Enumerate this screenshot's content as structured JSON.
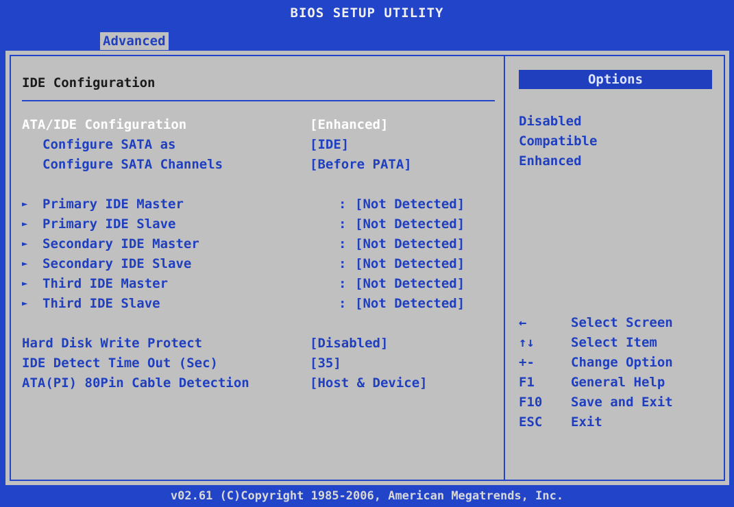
{
  "header": {
    "title": "BIOS SETUP UTILITY",
    "active_tab": "Advanced"
  },
  "section": {
    "title": "IDE Configuration"
  },
  "settings": [
    {
      "label": "ATA/IDE Configuration",
      "value": "[Enhanced]",
      "selected": true
    },
    {
      "label": "Configure SATA as",
      "value": "[IDE]"
    },
    {
      "label": "Configure SATA Channels",
      "value": "[Before PATA]"
    }
  ],
  "submenus": [
    {
      "label": "Primary IDE Master",
      "value": "[Not Detected]"
    },
    {
      "label": "Primary IDE Slave",
      "value": "[Not Detected]"
    },
    {
      "label": "Secondary IDE Master",
      "value": "[Not Detected]"
    },
    {
      "label": "Secondary IDE Slave",
      "value": "[Not Detected]"
    },
    {
      "label": "Third IDE Master",
      "value": "[Not Detected]"
    },
    {
      "label": "Third IDE Slave",
      "value": "[Not Detected]"
    }
  ],
  "misc_settings": [
    {
      "label": "Hard Disk Write Protect",
      "value": "[Disabled]"
    },
    {
      "label": "IDE Detect Time Out (Sec)",
      "value": "[35]"
    },
    {
      "label": "ATA(PI) 80Pin Cable Detection",
      "value": "[Host & Device]"
    }
  ],
  "submenu_marker": "►",
  "submenu_separator": ":",
  "options": {
    "header": "Options",
    "items": [
      "Disabled",
      "Compatible",
      "Enhanced"
    ]
  },
  "help_keys": [
    {
      "key": "←",
      "desc": "Select Screen"
    },
    {
      "key": "↑↓",
      "desc": "Select Item"
    },
    {
      "key": "+-",
      "desc": "Change Option"
    },
    {
      "key": "F1",
      "desc": "General Help"
    },
    {
      "key": "F10",
      "desc": "Save and Exit"
    },
    {
      "key": "ESC",
      "desc": "Exit"
    }
  ],
  "footer": {
    "text": "v02.61 (C)Copyright 1985-2006, American Megatrends, Inc."
  },
  "colors": {
    "bios_blue": "#2244c8",
    "panel_gray": "#c0c0c0",
    "highlight_white": "#ffffff"
  }
}
